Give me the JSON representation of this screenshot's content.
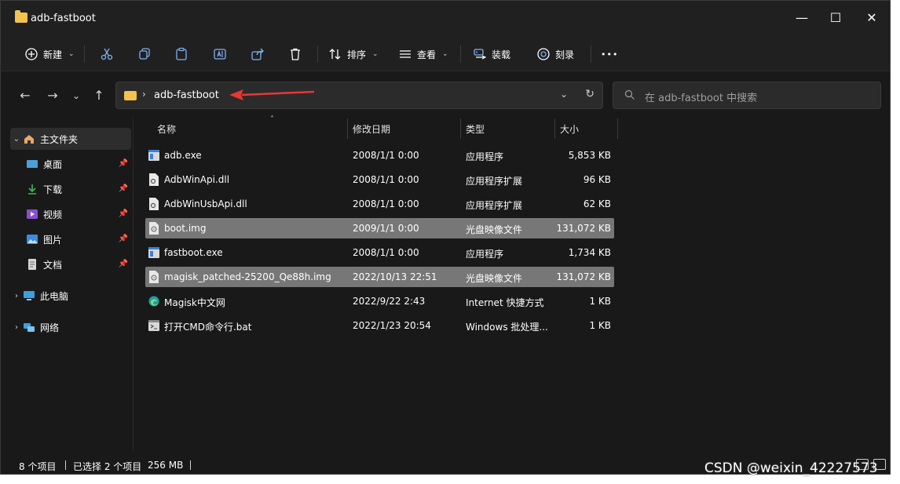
{
  "window": {
    "title": "adb-fastboot",
    "minimize": "—",
    "maximize": "☐",
    "close": "✕"
  },
  "toolbar": {
    "new_label": "新建",
    "sort_label": "排序",
    "view_label": "查看",
    "mount_label": "装载",
    "burn_label": "刻录",
    "more_label": "•••"
  },
  "address": {
    "path": "adb-fastboot",
    "search_placeholder": "在 adb-fastboot 中搜索"
  },
  "sidebar": {
    "items": [
      {
        "label": "主文件夹"
      },
      {
        "label": "桌面"
      },
      {
        "label": "下载"
      },
      {
        "label": "视频"
      },
      {
        "label": "图片"
      },
      {
        "label": "文档"
      },
      {
        "label": "此电脑"
      },
      {
        "label": "网络"
      }
    ]
  },
  "columns": {
    "name": "名称",
    "date": "修改日期",
    "type": "类型",
    "size": "大小"
  },
  "files": [
    {
      "name": "adb.exe",
      "date": "2008/1/1 0:00",
      "type": "应用程序",
      "size": "5,853 KB",
      "icon": "exe-icon",
      "selected": false
    },
    {
      "name": "AdbWinApi.dll",
      "date": "2008/1/1 0:00",
      "type": "应用程序扩展",
      "size": "96 KB",
      "icon": "dll-icon",
      "selected": false
    },
    {
      "name": "AdbWinUsbApi.dll",
      "date": "2008/1/1 0:00",
      "type": "应用程序扩展",
      "size": "62 KB",
      "icon": "dll-icon",
      "selected": false
    },
    {
      "name": "boot.img",
      "date": "2009/1/1 0:00",
      "type": "光盘映像文件",
      "size": "131,072 KB",
      "icon": "img-icon",
      "selected": true
    },
    {
      "name": "fastboot.exe",
      "date": "2008/1/1 0:00",
      "type": "应用程序",
      "size": "1,734 KB",
      "icon": "exe-icon",
      "selected": false
    },
    {
      "name": "magisk_patched-25200_Qe88h.img",
      "date": "2022/10/13 22:51",
      "type": "光盘映像文件",
      "size": "131,072 KB",
      "icon": "img-icon",
      "selected": true
    },
    {
      "name": "Magisk中文网",
      "date": "2022/9/22 2:43",
      "type": "Internet 快捷方式",
      "size": "1 KB",
      "icon": "edge-icon",
      "selected": false
    },
    {
      "name": "打开CMD命令行.bat",
      "date": "2022/1/23 20:54",
      "type": "Windows 批处理...",
      "size": "1 KB",
      "icon": "bat-icon",
      "selected": false
    }
  ],
  "status": {
    "count": "8 个项目",
    "selection": "已选择 2 个项目",
    "size": "256 MB"
  },
  "watermark": "CSDN @weixin_42227573",
  "colors": {
    "background": "#191919",
    "selection": "#777777",
    "folder": "#f4c24f",
    "arrow": "#e53935"
  }
}
